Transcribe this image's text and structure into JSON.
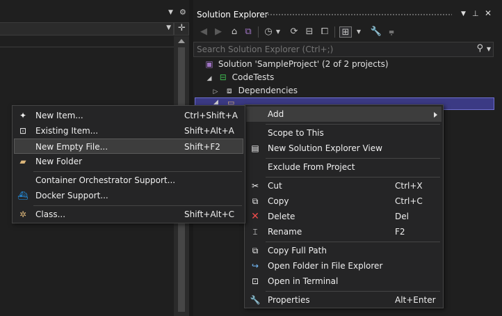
{
  "solution_explorer": {
    "title": "Solution Explorer",
    "search_placeholder": "Search Solution Explorer (Ctrl+;)",
    "tree": {
      "solution": "Solution 'SampleProject' (2 of 2 projects)",
      "project": "CodeTests",
      "dependencies": "Dependencies"
    }
  },
  "context_menu": {
    "items": {
      "add": {
        "label": "Add"
      },
      "scope_to_this": {
        "label": "Scope to This"
      },
      "new_view": {
        "label": "New Solution Explorer View"
      },
      "exclude": {
        "label": "Exclude From Project"
      },
      "cut": {
        "label": "Cut",
        "shortcut": "Ctrl+X"
      },
      "copy": {
        "label": "Copy",
        "shortcut": "Ctrl+C"
      },
      "delete": {
        "label": "Delete",
        "shortcut": "Del"
      },
      "rename": {
        "label": "Rename",
        "shortcut": "F2"
      },
      "copy_full_path": {
        "label": "Copy Full Path"
      },
      "open_folder": {
        "label": "Open Folder in File Explorer"
      },
      "open_terminal": {
        "label": "Open in Terminal"
      },
      "properties": {
        "label": "Properties",
        "shortcut": "Alt+Enter"
      }
    }
  },
  "add_submenu": {
    "items": {
      "new_item": {
        "label": "New Item...",
        "shortcut": "Ctrl+Shift+A"
      },
      "existing_item": {
        "label": "Existing Item...",
        "shortcut": "Shift+Alt+A"
      },
      "new_empty_file": {
        "label": "New Empty File...",
        "shortcut": "Shift+F2"
      },
      "new_folder": {
        "label": "New Folder"
      },
      "container_orchestrator": {
        "label": "Container Orchestrator Support..."
      },
      "docker_support": {
        "label": "Docker Support..."
      },
      "class": {
        "label": "Class...",
        "shortcut": "Shift+Alt+C"
      }
    }
  },
  "colors": {
    "background": "#1f1f1f",
    "menu_background": "#252526",
    "selection": "#3b3a84",
    "delete_icon": "#f14c4c",
    "vs_purple": "#a074c4"
  }
}
